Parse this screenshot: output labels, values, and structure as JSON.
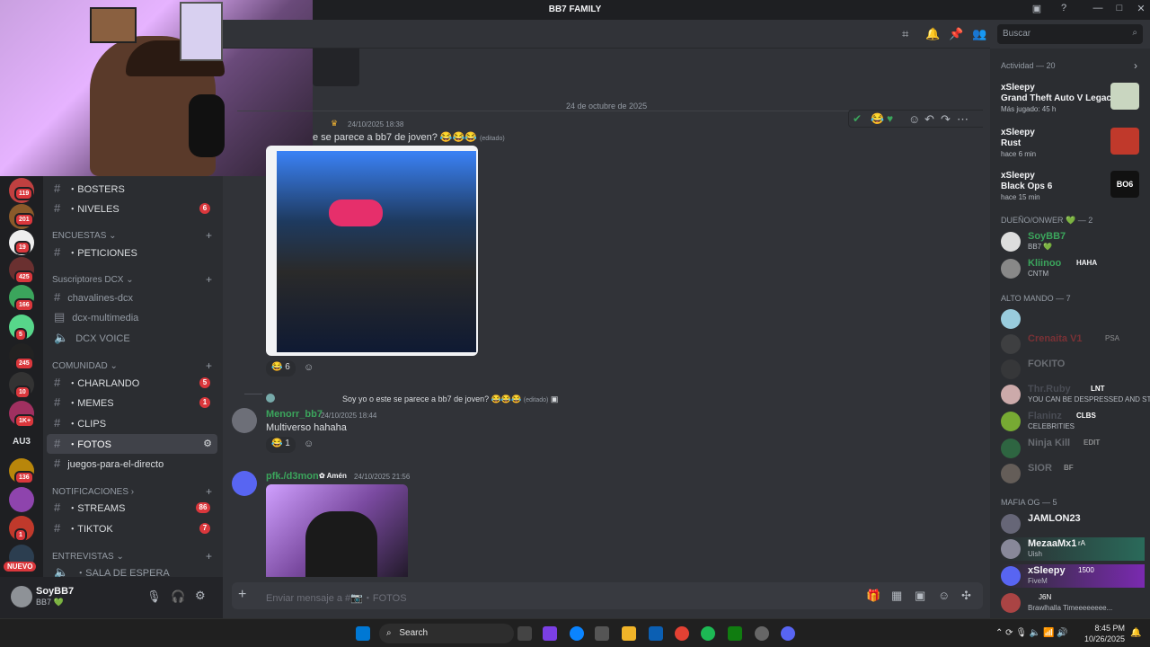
{
  "window": {
    "title": "BB7 FAMILY"
  },
  "servers": [
    {
      "badge": "119"
    },
    {
      "badge": "201"
    },
    {
      "badge": "19"
    },
    {
      "badge": "425"
    },
    {
      "badge": "166"
    },
    {
      "badge": "5"
    },
    {
      "badge": "245"
    },
    {
      "badge": "10"
    },
    {
      "badge": "1K+"
    },
    {
      "label": "AU3"
    },
    {
      "badge": "136"
    },
    {
      "badge": ""
    },
    {
      "badge": "1"
    },
    {
      "label": "NUEVO"
    }
  ],
  "channels": {
    "items_top": [
      {
        "name": "・BOSTERS",
        "badge": ""
      },
      {
        "name": "・NIVELES",
        "badge": "6"
      }
    ],
    "cat_encuestas": "ENCUESTAS",
    "peticiones": "・PETICIONES",
    "cat_subs": "Suscriptores DCX",
    "chavalines": "chavalines-dcx",
    "multimedia": "dcx-multimedia",
    "voice": "DCX VOICE",
    "cat_comunidad": "COMUNIDAD",
    "charlando": "・CHARLANDO",
    "charlando_badge": "5",
    "memes": "・MEMES",
    "memes_badge": "1",
    "clips": "・CLIPS",
    "fotos": "・FOTOS",
    "juegos": "juegos-para-el-directo",
    "cat_notif": "NOTIFICACIONES",
    "streams": "・STREAMS",
    "streams_badge": "86",
    "tiktok": "・TIKTOK",
    "tiktok_badge": "7",
    "cat_entrevistas": "ENTREVISTAS",
    "sala": "・SALA DE ESPERA"
  },
  "user": {
    "name": "SoyBB7",
    "status": "BB7 💚"
  },
  "search": {
    "placeholder": "Buscar"
  },
  "messages": {
    "date_divider": "24 de octubre de 2025",
    "m1_time": "24/10/2025 18:38",
    "m1_text": "e se parece a bb7 de joven? 😂😂😂",
    "m1_edited": "(editado)",
    "m1_react": "6",
    "m2_reply": "Soy yo o este se parece a bb7 de joven? 😂😂😂",
    "m2_reply_edited": "(editado)",
    "m2_author": "Menorr_bb7",
    "m2_time": "24/10/2025 18:44",
    "m2_text": "Multiverso hahaha",
    "m2_react": "1",
    "m3_author": "pfk./d3mon",
    "m3_tag": "Amén",
    "m3_time": "24/10/2025 21:56"
  },
  "composer": {
    "placeholder": "Enviar mensaje a #📷・FOTOS"
  },
  "members": {
    "activity_title": "Actividad — 20",
    "activities": [
      {
        "name": "xSleepy",
        "game": "Grand Theft Auto V Legacy",
        "sub": "Más jugado: 45 h"
      },
      {
        "name": "xSleepy",
        "game": "Rust",
        "sub": "hace 6 min"
      },
      {
        "name": "xSleepy",
        "game": "Black Ops 6",
        "sub": "hace 15 min"
      }
    ],
    "sect_owner": "DUEÑO/ONWER 💚 — 2",
    "owner1": {
      "name": "SoyBB7",
      "sub": "BB7 💚"
    },
    "owner2": {
      "name": "Kliinoo",
      "tag": "HAHA",
      "sub": "CNTM"
    },
    "sect_alto": "ALTO MANDO — 7",
    "alto": [
      {
        "name": "",
        "tag": ""
      },
      {
        "name": "Crenaita V1",
        "tag": "PSA"
      },
      {
        "name": "FOKITO",
        "tag": ""
      },
      {
        "name": "Thr.Ruby",
        "tag": "LNT",
        "sub": "YOU CAN BE DESPRESSED AND STILL ..."
      },
      {
        "name": "Flaninz",
        "tag": "CLBS",
        "sub": "CELEBRITIES"
      },
      {
        "name": "Ninja Kill",
        "tag": "EDIT"
      },
      {
        "name": "SIOR",
        "tag": "BF"
      }
    ],
    "sect_mafia": "MAFIA OG — 5",
    "mafia": [
      {
        "name": "JAMLON23",
        "tag": "",
        "sub": ""
      },
      {
        "name": "MezaaMx1",
        "tag": "rA",
        "sub": "Uish"
      },
      {
        "name": "xSleepy",
        "tag": "1500",
        "sub": "FiveM"
      },
      {
        "name": "",
        "tag": "J6N",
        "sub": "Brawlhalla Timeeeeeeee..."
      }
    ]
  },
  "taskbar": {
    "search": "Search",
    "time": "8:45 PM",
    "date": "10/26/2025"
  }
}
